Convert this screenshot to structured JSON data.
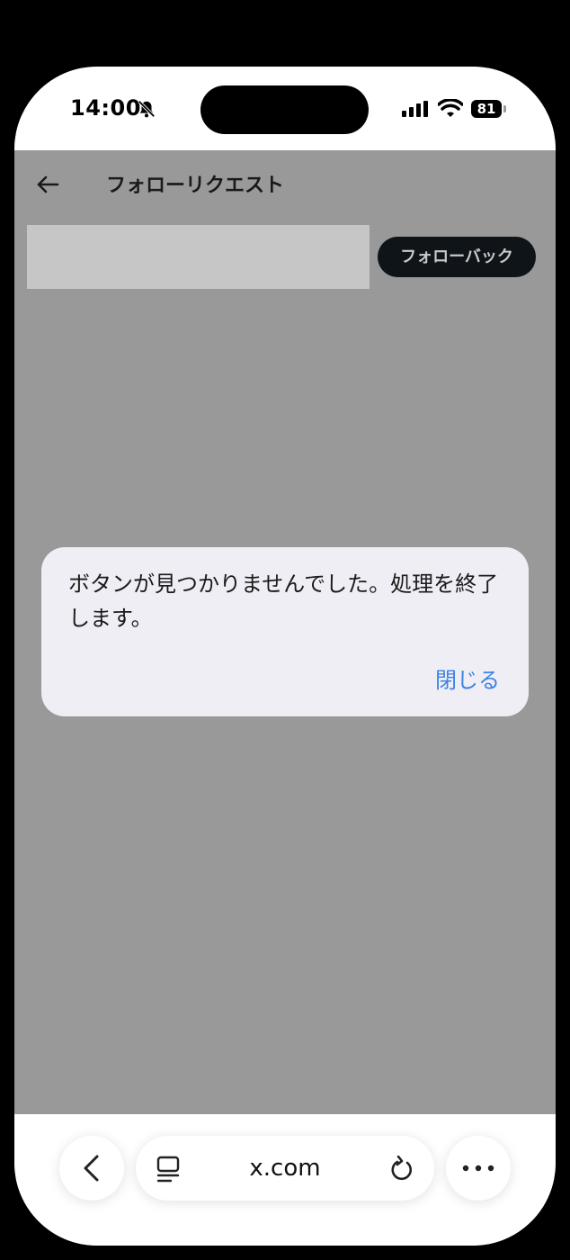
{
  "status_bar": {
    "time": "14:00",
    "battery": "81",
    "icons": [
      "bell-slash-icon",
      "signal-icon",
      "wifi-icon",
      "battery-icon"
    ]
  },
  "header": {
    "title": "フォローリクエスト",
    "back_icon": "back-arrow-icon"
  },
  "request": {
    "follow_back_label": "フォローバック"
  },
  "dialog": {
    "message": "ボタンが見つかりませんでした。処理を終了します。",
    "close_label": "閉じる"
  },
  "browser_bar": {
    "url": "x.com",
    "icons": [
      "chevron-left-icon",
      "tabs-icon",
      "reload-icon",
      "more-icon"
    ]
  },
  "colors": {
    "overlay": "#999999",
    "dialog_bg": "#efeef5",
    "accent": "#3b82e6",
    "button_bg": "#0f1419"
  }
}
